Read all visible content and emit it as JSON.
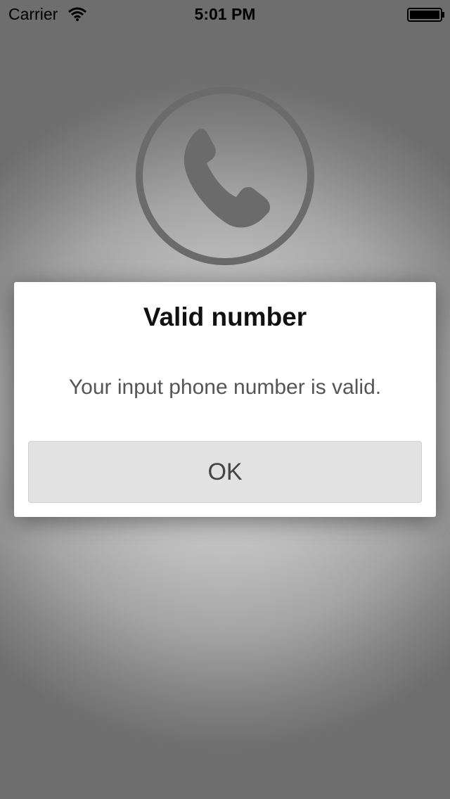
{
  "status_bar": {
    "carrier": "Carrier",
    "time": "5:01 PM",
    "wifi_icon": "wifi-icon",
    "battery_icon": "battery-icon"
  },
  "background": {
    "icon": "phone-icon",
    "icon_color": "#6b6b6b"
  },
  "dialog": {
    "title": "Valid number",
    "message": "Your input phone number is valid.",
    "ok_label": "OK"
  },
  "colors": {
    "dialog_bg": "#ffffff",
    "button_bg": "#e2e2e2",
    "title_text": "#111111",
    "message_text": "#555555"
  }
}
